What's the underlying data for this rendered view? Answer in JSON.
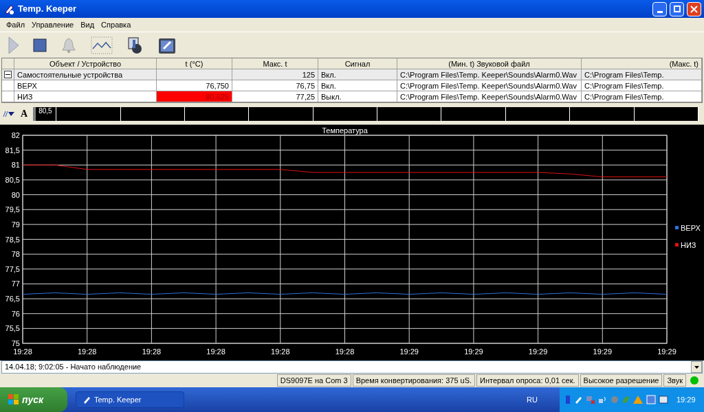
{
  "window": {
    "title": "Temp. Keeper"
  },
  "menu": [
    "Файл",
    "Управление",
    "Вид",
    "Справка"
  ],
  "toolbar": [
    {
      "kind": "play",
      "disabled": true
    },
    {
      "kind": "stop",
      "disabled": false
    },
    {
      "kind": "bell",
      "disabled": true
    },
    {
      "kind": "chart",
      "disabled": false
    },
    {
      "kind": "device",
      "disabled": false
    },
    {
      "kind": "properties",
      "disabled": false
    }
  ],
  "table": {
    "columns": [
      "Объект / Устройство",
      "t (°C)",
      "Макс. t",
      "Сигнал",
      "(Мин. t) Звуковой файл",
      "(Макс. t)"
    ],
    "groups": [
      {
        "name": "Самостоятельные устройства",
        "expanded": true,
        "max": "125",
        "signal": "Вкл.",
        "sound_min": "C:\\Program Files\\Temp. Keeper\\Sounds\\Alarm0.Wav",
        "sound_max": "C:\\Program Files\\Temp.",
        "children": [
          {
            "name": "ВЕРХ",
            "t": "76,750",
            "alarm": false,
            "max": "76,75",
            "signal": "Вкл.",
            "sound_min": "C:\\Program Files\\Temp. Keeper\\Sounds\\Alarm0.Wav",
            "sound_max": "C:\\Program Files\\Temp."
          },
          {
            "name": "НИЗ",
            "t": "80,625",
            "alarm": true,
            "max": "77,25",
            "signal": "Выкл.",
            "sound_min": "C:\\Program Files\\Temp. Keeper\\Sounds\\Alarm0.Wav",
            "sound_max": "C:\\Program Files\\Temp."
          }
        ]
      }
    ]
  },
  "strip": {
    "font_button": "A",
    "reading": "80,5"
  },
  "chart": {
    "chart_data": {
      "type": "line",
      "title": "Температура",
      "categories": [
        "19:28",
        null,
        "19:28",
        null,
        "19:28",
        null,
        "19:28",
        null,
        "19:28",
        null,
        "19:28",
        null,
        "19:29",
        null,
        "19:29",
        null,
        "19:29",
        null,
        "19:29",
        null,
        "19:29"
      ],
      "ylim": [
        75,
        82
      ],
      "grid": true,
      "legend": "right",
      "yticks": [
        75,
        {
          "value": 75.5,
          "label": "75,5"
        },
        76,
        {
          "value": 76.5,
          "label": "76,5"
        },
        77,
        {
          "value": 77.5,
          "label": "77,5"
        },
        78,
        {
          "value": 78.5,
          "label": "78,5"
        },
        79,
        {
          "value": 79.5,
          "label": "79,5"
        },
        80,
        {
          "value": 80.5,
          "label": "80,5"
        },
        81,
        {
          "value": 81.5,
          "label": "81,5"
        },
        82
      ],
      "series": [
        {
          "name": "ВЕРХ",
          "color": "#3070e0",
          "values": [
            76.65,
            76.7,
            76.65,
            76.7,
            76.65,
            76.7,
            76.65,
            76.7,
            76.65,
            76.7,
            76.65,
            76.7,
            76.65,
            76.7,
            76.65,
            76.7,
            76.65,
            76.7,
            76.65,
            76.7,
            76.65
          ]
        },
        {
          "name": "НИЗ",
          "color": "#e01010",
          "values": [
            81,
            81,
            80.85,
            80.85,
            80.85,
            80.85,
            80.85,
            80.85,
            80.85,
            80.75,
            80.75,
            80.75,
            80.75,
            80.75,
            80.75,
            80.75,
            80.75,
            80.7,
            80.6,
            80.6,
            80.6
          ]
        }
      ]
    }
  },
  "log": {
    "value": "14.04.18; 9:02:05 - Начато наблюдение"
  },
  "status_bar": {
    "panels": [
      "DS9097E на Com 3",
      "Время конвертирования: 375 uS.",
      "Интервал опроса: 0,01 сек.",
      "Высокое разрешение",
      "Звук"
    ],
    "indicator_on": true
  },
  "taskbar": {
    "start": "пуск",
    "tasks": [
      "Temp. Keeper"
    ],
    "language": "RU",
    "clock": "19:29"
  }
}
